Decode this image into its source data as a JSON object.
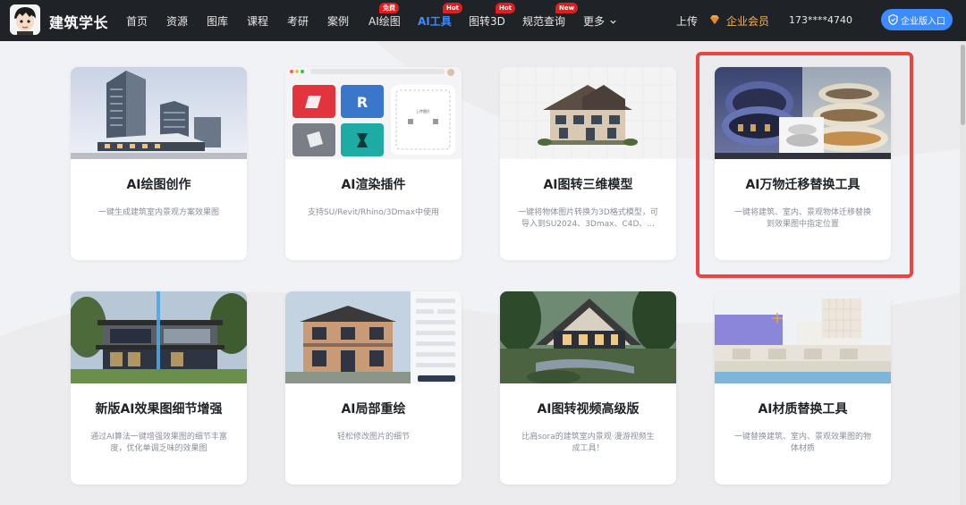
{
  "brand": {
    "name": "建筑学长",
    "logo_icon": "cartoon-avatar-icon"
  },
  "nav": [
    {
      "label": "首页"
    },
    {
      "label": "资源"
    },
    {
      "label": "图库"
    },
    {
      "label": "课程"
    },
    {
      "label": "考研"
    },
    {
      "label": "案例"
    },
    {
      "label": "AI绘图",
      "badge": "免费"
    },
    {
      "label": "AI工具",
      "badge": "Hot",
      "active": true
    },
    {
      "label": "图转3D",
      "badge": "Hot"
    },
    {
      "label": "规范查询",
      "badge": "New"
    },
    {
      "label": "更多"
    }
  ],
  "header_right": {
    "upload": "上传",
    "vip": "企业会员",
    "phone": "173****4740",
    "enterprise_button": "企业版入口"
  },
  "colors": {
    "header_bg": "#1f2327",
    "accent": "#3d8bff",
    "badge": "#e21d1d",
    "highlight": "#ec4343",
    "vip": "#f0b35a"
  },
  "cards": [
    {
      "title": "AI绘图创作",
      "desc": "一键生成建筑室内景观方案效果图",
      "image": "high-rise-building-render"
    },
    {
      "title": "AI渲染插件",
      "desc": "支持SU/Revit/Rhino/3Dmax中使用",
      "image": "plugin-ui-screenshot"
    },
    {
      "title": "AI图转三维模型",
      "desc": "一键将物体图片转换为3D格式模型，可导入到SU2024、3Dmax、C4D、...",
      "image": "villa-3d-model"
    },
    {
      "title": "AI万物迁移替换工具",
      "desc": "一键将建筑、室内、景观物体迁移替换到效果图中指定位置",
      "image": "spiral-building-transfer",
      "highlighted": true
    },
    {
      "title": "新版AI效果图细节增强",
      "desc": "通过AI算法一键增强效果图的细节丰富度，优化单调乏味的效果图",
      "image": "modern-villa-enhance"
    },
    {
      "title": "AI局部重绘",
      "desc": "轻松修改图片的细节",
      "image": "house-inpaint-ui"
    },
    {
      "title": "AI图转视频高级版",
      "desc": "比肩sora的建筑室内景观·漫游视频生成工具！",
      "image": "forest-house-video"
    },
    {
      "title": "AI材质替换工具",
      "desc": "一键替换建筑、室内、景观效果图的物体材质",
      "image": "material-swap-building"
    }
  ],
  "plugin_mock": {
    "upload_label": "上传图片"
  }
}
